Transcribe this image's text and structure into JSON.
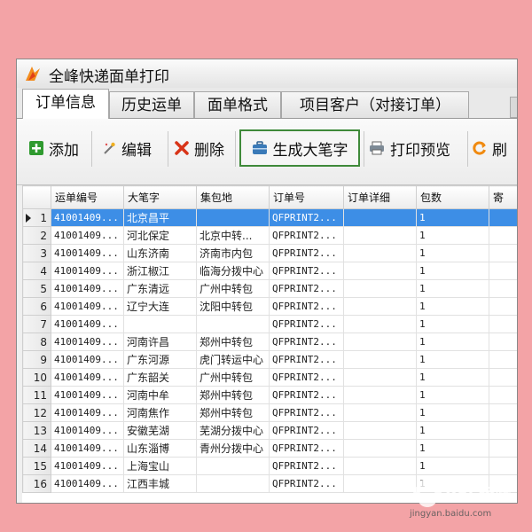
{
  "window": {
    "title": "全峰快递面单打印"
  },
  "tabs": [
    {
      "label": "订单信息",
      "active": true
    },
    {
      "label": "历史运单",
      "active": false
    },
    {
      "label": "面单格式",
      "active": false
    },
    {
      "label": "项目客户（对接订单）",
      "active": false
    }
  ],
  "toolbar": {
    "add_label": "添加",
    "edit_label": "编辑",
    "delete_label": "删除",
    "generate_label": "生成大笔字",
    "preview_label": "打印预览",
    "refresh_label": "刷"
  },
  "grid": {
    "columns": [
      "运单编号",
      "大笔字",
      "集包地",
      "订单号",
      "订单详细",
      "包数",
      "寄"
    ],
    "selected_row": 1,
    "rows": [
      {
        "num": "1",
        "waybill": "41001409...",
        "bigword": "北京昌平",
        "hub": "",
        "order": "QFPRINT2...",
        "detail": "",
        "packs": "1",
        "send": ""
      },
      {
        "num": "2",
        "waybill": "41001409...",
        "bigword": "河北保定",
        "hub": "北京中转...",
        "order": "QFPRINT2...",
        "detail": "",
        "packs": "1",
        "send": ""
      },
      {
        "num": "3",
        "waybill": "41001409...",
        "bigword": "山东济南",
        "hub": "济南市内包",
        "order": "QFPRINT2...",
        "detail": "",
        "packs": "1",
        "send": ""
      },
      {
        "num": "4",
        "waybill": "41001409...",
        "bigword": "浙江椒江",
        "hub": "临海分拨中心",
        "order": "QFPRINT2...",
        "detail": "",
        "packs": "1",
        "send": ""
      },
      {
        "num": "5",
        "waybill": "41001409...",
        "bigword": "广东清远",
        "hub": "广州中转包",
        "order": "QFPRINT2...",
        "detail": "",
        "packs": "1",
        "send": ""
      },
      {
        "num": "6",
        "waybill": "41001409...",
        "bigword": "辽宁大连",
        "hub": "沈阳中转包",
        "order": "QFPRINT2...",
        "detail": "",
        "packs": "1",
        "send": ""
      },
      {
        "num": "7",
        "waybill": "41001409...",
        "bigword": "",
        "hub": "",
        "order": "QFPRINT2...",
        "detail": "",
        "packs": "1",
        "send": ""
      },
      {
        "num": "8",
        "waybill": "41001409...",
        "bigword": "河南许昌",
        "hub": "郑州中转包",
        "order": "QFPRINT2...",
        "detail": "",
        "packs": "1",
        "send": ""
      },
      {
        "num": "9",
        "waybill": "41001409...",
        "bigword": "广东河源",
        "hub": "虎门转运中心",
        "order": "QFPRINT2...",
        "detail": "",
        "packs": "1",
        "send": ""
      },
      {
        "num": "10",
        "waybill": "41001409...",
        "bigword": "广东韶关",
        "hub": "广州中转包",
        "order": "QFPRINT2...",
        "detail": "",
        "packs": "1",
        "send": ""
      },
      {
        "num": "11",
        "waybill": "41001409...",
        "bigword": "河南中牟",
        "hub": "郑州中转包",
        "order": "QFPRINT2...",
        "detail": "",
        "packs": "1",
        "send": ""
      },
      {
        "num": "12",
        "waybill": "41001409...",
        "bigword": "河南焦作",
        "hub": "郑州中转包",
        "order": "QFPRINT2...",
        "detail": "",
        "packs": "1",
        "send": ""
      },
      {
        "num": "13",
        "waybill": "41001409...",
        "bigword": "安徽芜湖",
        "hub": "芜湖分拨中心",
        "order": "QFPRINT2...",
        "detail": "",
        "packs": "1",
        "send": ""
      },
      {
        "num": "14",
        "waybill": "41001409...",
        "bigword": "山东淄博",
        "hub": "青州分拨中心",
        "order": "QFPRINT2...",
        "detail": "",
        "packs": "1",
        "send": ""
      },
      {
        "num": "15",
        "waybill": "41001409...",
        "bigword": "上海宝山",
        "hub": "",
        "order": "QFPRINT2...",
        "detail": "",
        "packs": "1",
        "send": ""
      },
      {
        "num": "16",
        "waybill": "41001409...",
        "bigword": "江西丰城",
        "hub": "",
        "order": "QFPRINT2...",
        "detail": "",
        "packs": "1",
        "send": ""
      }
    ]
  },
  "watermark": {
    "text": "Bai 经验",
    "url": "jingyan.baidu.com"
  },
  "colors": {
    "selection": "#3d8ee6",
    "highlight_border": "#3f8a3a",
    "background": "#f3a3a6"
  }
}
